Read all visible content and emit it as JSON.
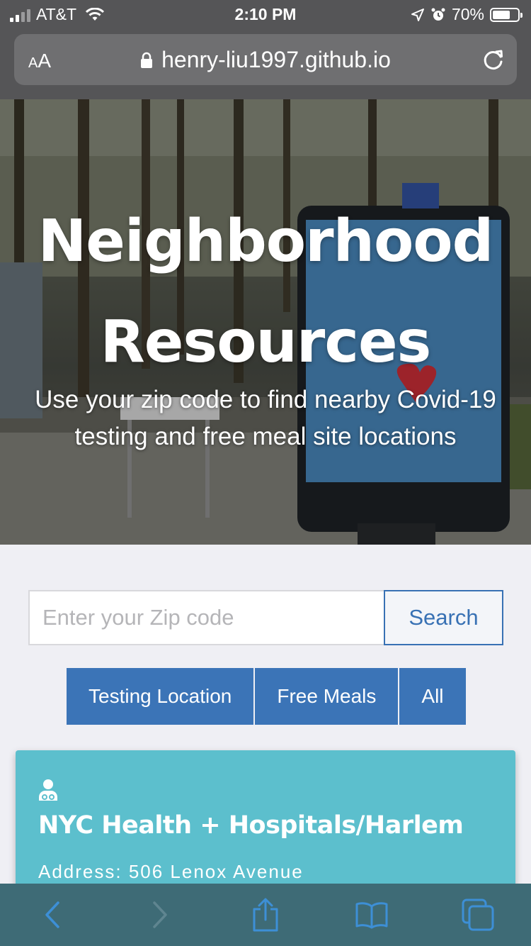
{
  "status_bar": {
    "carrier": "AT&T",
    "time": "2:10 PM",
    "battery_percent": "70%",
    "battery_level": 0.7,
    "icons": [
      "signal-icon",
      "wifi-icon",
      "location-arrow-icon",
      "alarm-icon",
      "battery-icon"
    ]
  },
  "browser": {
    "text_size_label_small": "A",
    "text_size_label_large": "A",
    "url": "henry-liu1997.github.io",
    "icons": [
      "lock-icon",
      "reload-icon"
    ]
  },
  "hero": {
    "title_line1": "Neighborhood",
    "title_line2": "Resources",
    "subtitle_line1": "Use your zip code to find nearby Covid-19",
    "subtitle_line2": "testing and free meal site locations"
  },
  "search": {
    "placeholder": "Enter your Zip code",
    "value": "",
    "button_label": "Search"
  },
  "filters": [
    {
      "label": "Testing Location"
    },
    {
      "label": "Free Meals"
    },
    {
      "label": "All"
    }
  ],
  "results": [
    {
      "icon": "doctor-icon",
      "name": "NYC Health + Hospitals/Harlem",
      "address": "Address: 506 Lenox Avenue"
    }
  ],
  "toolbar": {
    "icons": [
      "back-icon",
      "forward-icon",
      "share-icon",
      "bookmarks-icon",
      "tabs-icon"
    ]
  },
  "colors": {
    "chrome": "#555557",
    "accent_blue": "#3b74b7",
    "card_teal": "#5cbfcd",
    "toolbar": "#3e6b76"
  }
}
